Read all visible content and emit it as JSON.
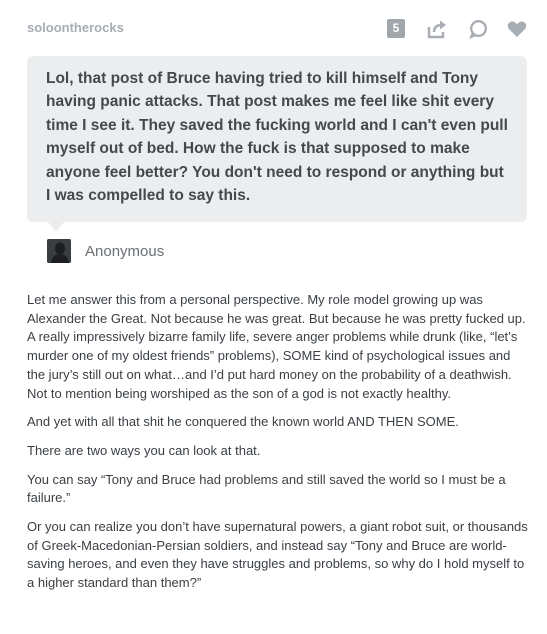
{
  "header": {
    "blog_name": "soloontherocks",
    "note_count": "5"
  },
  "icons": [
    "share-icon",
    "reply-icon",
    "heart-icon"
  ],
  "question": {
    "text": "Lol, that post of Bruce having tried to kill himself and Tony having panic attacks. That post makes me feel like shit every time I see it. They saved the fucking world and I can't even pull myself out of bed. How the fuck is that supposed to make anyone feel better? You don't need to respond or anything but I was compelled to say this.",
    "asker": "Anonymous"
  },
  "answer": {
    "paragraphs": [
      "Let me answer this from a personal perspective. My role model growing up was Alexander the Great. Not because he was great. But because he was pretty fucked up. A really impressively bizarre family life, severe anger problems while drunk (like, “let’s murder one of my oldest friends” problems), SOME kind of psychological issues and the jury’s still out on what…and I’d put hard money on the probability of a deathwish. Not to mention being worshiped as the son of a god is not exactly healthy.",
      "And yet with all that shit he conquered the known world AND THEN SOME.",
      "There are two ways you can look at that.",
      "You can say “Tony and Bruce had problems and still saved the world so I must be a failure.”",
      "Or you can realize you don’t have supernatural powers, a giant robot suit, or thousands of Greek-Macedonian-Persian soldiers, and instead say “Tony and Bruce are world-saving heroes, and even they have struggles and problems, so why do I hold myself to a higher standard than them?”"
    ]
  },
  "colors": {
    "icon": "#a7adb3",
    "bubble": "#ecedee",
    "question_text": "#44494e",
    "body_text": "#3a3f44"
  }
}
